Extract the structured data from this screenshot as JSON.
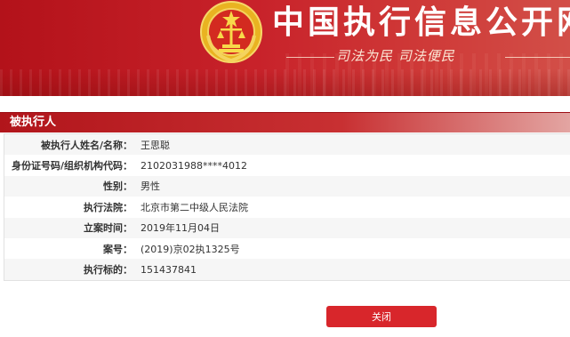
{
  "header": {
    "site_title": "中国执行信息公开网",
    "slogan": "司法为民  司法便民"
  },
  "section": {
    "title": "被执行人"
  },
  "rows": [
    {
      "label": "被执行人姓名/名称：",
      "value": "王思聪"
    },
    {
      "label": "身份证号码/组织机构代码：",
      "value": "2102031988****4012"
    },
    {
      "label": "性别：",
      "value": "男性"
    },
    {
      "label": "执行法院：",
      "value": "北京市第二中级人民法院"
    },
    {
      "label": "立案时间：",
      "value": "2019年11月04日"
    },
    {
      "label": "案号：",
      "value": "(2019)京02执1325号"
    },
    {
      "label": "执行标的：",
      "value": "151437841"
    }
  ],
  "actions": {
    "close_label": "关闭"
  },
  "colors": {
    "brand_red": "#c41a21",
    "button_red": "#d8262b"
  },
  "icons": {
    "emblem": "court-emblem-icon"
  }
}
